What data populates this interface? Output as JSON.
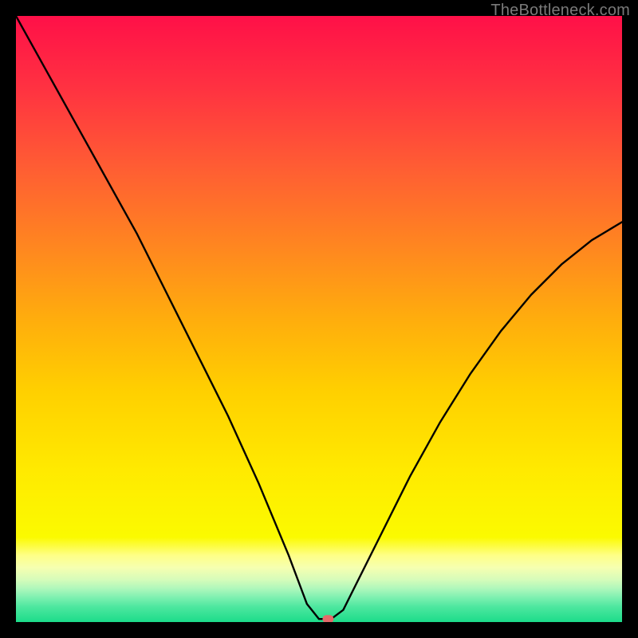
{
  "watermark": "TheBottleneck.com",
  "chart_data": {
    "type": "line",
    "title": "",
    "xlabel": "",
    "ylabel": "",
    "xlim": [
      0,
      100
    ],
    "ylim": [
      0,
      100
    ],
    "series": [
      {
        "name": "bottleneck-curve",
        "x": [
          0,
          5,
          10,
          15,
          20,
          25,
          30,
          35,
          40,
          45,
          48,
          50,
          52,
          54,
          56,
          60,
          65,
          70,
          75,
          80,
          85,
          90,
          95,
          100
        ],
        "y": [
          100,
          91,
          82,
          73,
          64,
          54,
          44,
          34,
          23,
          11,
          3,
          0.5,
          0.5,
          2,
          6,
          14,
          24,
          33,
          41,
          48,
          54,
          59,
          63,
          66
        ]
      }
    ],
    "marker": {
      "x": 51.5,
      "y": 0.5
    },
    "background_bands": [
      {
        "from": 100,
        "to": 11,
        "colors": [
          "#ff1048",
          "#ff3e40",
          "#ff6a2e",
          "#ff951a",
          "#ffbe05",
          "#ffe300",
          "#fcf800"
        ]
      },
      {
        "from": 11,
        "to": 7,
        "color": "#feff87"
      },
      {
        "from": 7,
        "to": 6,
        "color": "#f6ffb0"
      },
      {
        "from": 6,
        "to": 5,
        "color": "#d6fcba"
      },
      {
        "from": 5,
        "to": 4,
        "color": "#aef7bb"
      },
      {
        "from": 4,
        "to": 3,
        "color": "#7cf0b0"
      },
      {
        "from": 3,
        "to": 2,
        "color": "#4de79f"
      },
      {
        "from": 2,
        "to": 0,
        "color": "#1cdc8a"
      }
    ]
  }
}
